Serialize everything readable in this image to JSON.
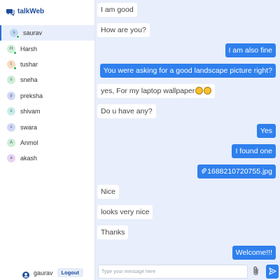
{
  "app": {
    "title": "talkWeb",
    "brand_color": "#1f4e9c"
  },
  "contacts": [
    {
      "name": "saurav",
      "initial": "s",
      "online": true,
      "active": true,
      "avatar_color": "#bfd8f5"
    },
    {
      "name": "Harsh",
      "initial": "H",
      "online": true,
      "active": false,
      "avatar_color": "#cdeed8"
    },
    {
      "name": "tushar",
      "initial": "t",
      "online": true,
      "active": false,
      "avatar_color": "#f6dcc2"
    },
    {
      "name": "sneha",
      "initial": "s",
      "online": false,
      "active": false,
      "avatar_color": "#cdeed8"
    },
    {
      "name": "preksha",
      "initial": "p",
      "online": false,
      "active": false,
      "avatar_color": "#cfd9f7"
    },
    {
      "name": "shivam",
      "initial": "s",
      "online": false,
      "active": false,
      "avatar_color": "#c8ede9"
    },
    {
      "name": "swara",
      "initial": "s",
      "online": false,
      "active": false,
      "avatar_color": "#cfd9f7"
    },
    {
      "name": "Anmol",
      "initial": "A",
      "online": false,
      "active": false,
      "avatar_color": "#cdeed8"
    },
    {
      "name": "akash",
      "initial": "a",
      "online": false,
      "active": false,
      "avatar_color": "#e6d4f5"
    }
  ],
  "footer": {
    "username": "gaurav",
    "logout_label": "Logout"
  },
  "messages": [
    {
      "text": "I am good",
      "dir": "in"
    },
    {
      "text": "How are you?",
      "dir": "in"
    },
    {
      "text": "I am also fine",
      "dir": "out"
    },
    {
      "text": "You were asking for a good landscape picture right?",
      "dir": "out"
    },
    {
      "text": "yes, For my laptop wallpaper",
      "dir": "in",
      "emoji": 2
    },
    {
      "text": "Do u have any?",
      "dir": "in"
    },
    {
      "text": "Yes",
      "dir": "out"
    },
    {
      "text": "I found one",
      "dir": "out"
    },
    {
      "text": "1688210720755.jpg",
      "dir": "out",
      "attachment": true
    },
    {
      "text": "Nice",
      "dir": "in"
    },
    {
      "text": "looks very nice",
      "dir": "in"
    },
    {
      "text": "Thanks",
      "dir": "in"
    },
    {
      "text": "Welcome!!!",
      "dir": "out"
    }
  ],
  "composer": {
    "placeholder": "Type your message here"
  },
  "colors": {
    "accent": "#2f80ed",
    "online": "#22b14c",
    "chat_bg": "#e8eefb"
  }
}
